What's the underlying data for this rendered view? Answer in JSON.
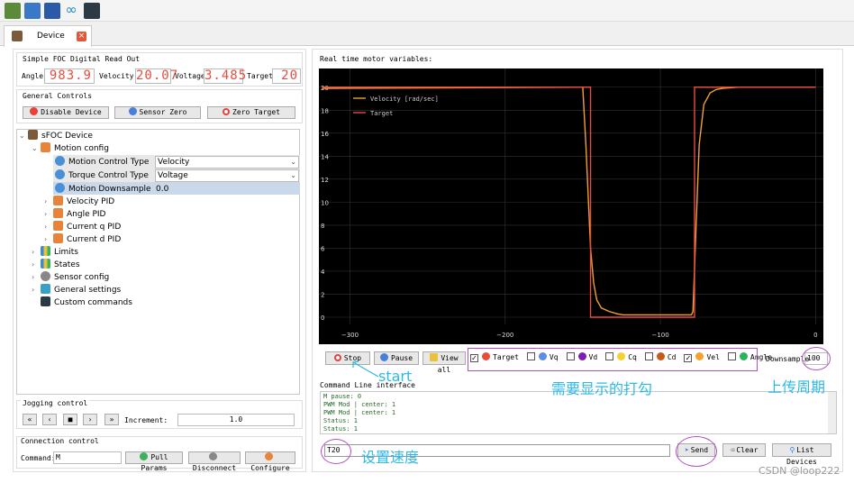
{
  "toolbar": {
    "icons": [
      "app-icon",
      "open-icon",
      "save-icon",
      "infinity-icon",
      "terminal-icon"
    ]
  },
  "tab": {
    "label": "Device",
    "close": "×"
  },
  "readout": {
    "title": "Simple FOC Digital Read Out",
    "angle_label": "Angle",
    "angle_value": "983.9",
    "velocity_label": "Velocity",
    "velocity_value": "20.07",
    "voltage_label": "Voltage",
    "voltage_value": "3.485",
    "target_label": "Target",
    "target_value": "20"
  },
  "general_controls": {
    "title": "General Controls",
    "disable": "Disable Device",
    "sensor_zero": "Sensor Zero",
    "zero_target": "Zero Target"
  },
  "tree": {
    "root": "sFOC Device",
    "motion_config": "Motion config",
    "motion_control_type": "Motion Control Type",
    "motion_control_value": "Velocity",
    "torque_control_type": "Torque Control Type",
    "torque_control_value": "Voltage",
    "motion_downsample": "Motion Downsample",
    "motion_downsample_value": "0.0",
    "velocity_pid": "Velocity PID",
    "angle_pid": "Angle PID",
    "current_q_pid": "Current q PID",
    "current_d_pid": "Current d PID",
    "limits": "Limits",
    "states": "States",
    "sensor_config": "Sensor config",
    "general_settings": "General settings",
    "custom_commands": "Custom commands"
  },
  "jogging": {
    "title": "Jogging control",
    "increment_label": "Increment:",
    "increment_value": "1.0"
  },
  "connection": {
    "title": "Connection control",
    "command_label": "Command:",
    "command_value": "M",
    "pull_params": "Pull Params",
    "disconnect": "Disconnect",
    "configure": "Configure"
  },
  "plot": {
    "title": "Real time motor variables:",
    "stop": "Stop",
    "pause": "Pause",
    "view_all": "View all",
    "signals": [
      {
        "label": "Target",
        "checked": true,
        "color": "#e84c3d"
      },
      {
        "label": "Vq",
        "checked": false,
        "color": "#5b8ee6"
      },
      {
        "label": "Vd",
        "checked": false,
        "color": "#7a1fb0"
      },
      {
        "label": "Cq",
        "checked": false,
        "color": "#f2d130"
      },
      {
        "label": "Cd",
        "checked": false,
        "color": "#c9581c"
      },
      {
        "label": "Vel",
        "checked": true,
        "color": "#f2a22e"
      },
      {
        "label": "Angle",
        "checked": false,
        "color": "#2fb35a"
      }
    ],
    "downsample_label": "Downsample",
    "downsample_value": "100"
  },
  "chart_data": {
    "type": "line",
    "xlim": [
      -320,
      5
    ],
    "ylim": [
      0,
      21
    ],
    "xticks": [
      -300,
      -200,
      -100,
      0
    ],
    "yticks": [
      0,
      2,
      4,
      6,
      8,
      10,
      12,
      14,
      16,
      18,
      20
    ],
    "grid": true,
    "legend": "top-left",
    "series": [
      {
        "name": "Velocity [rad/sec]",
        "color": "#f2a22e",
        "x": [
          -318,
          -150,
          -148,
          -145,
          -143,
          -141,
          -138,
          -133,
          -128,
          -124,
          -80,
          -79,
          -77,
          -75,
          -72,
          -68,
          -64,
          -60,
          -50,
          -30,
          0
        ],
        "y": [
          19.9,
          20.0,
          15.0,
          6.0,
          3.0,
          1.5,
          0.8,
          0.5,
          0.3,
          0.2,
          0.2,
          0.5,
          8.0,
          15.0,
          18.5,
          19.5,
          19.8,
          19.9,
          20.0,
          20.0,
          20.0
        ]
      },
      {
        "name": "Target",
        "color": "#e84c3d",
        "x": [
          -318,
          -145,
          -145,
          -78,
          -78,
          0
        ],
        "y": [
          20,
          20,
          0,
          0,
          20,
          20
        ]
      }
    ]
  },
  "cli": {
    "title": "Command Line interface",
    "lines": [
      "M pause: 0",
      "PWM Mod | center: 1",
      "PWM Mod | center: 1",
      "Status: 1",
      "Status: 1"
    ],
    "input_value": "T20",
    "send": "Send",
    "clear": "Clear",
    "list_devices": "List Devices"
  },
  "annotations": {
    "start": "start",
    "checkbox_note": "需要显示的打勾",
    "upload_note": "上传周期",
    "speed_note": "设置速度"
  },
  "watermark": "CSDN @loop222"
}
